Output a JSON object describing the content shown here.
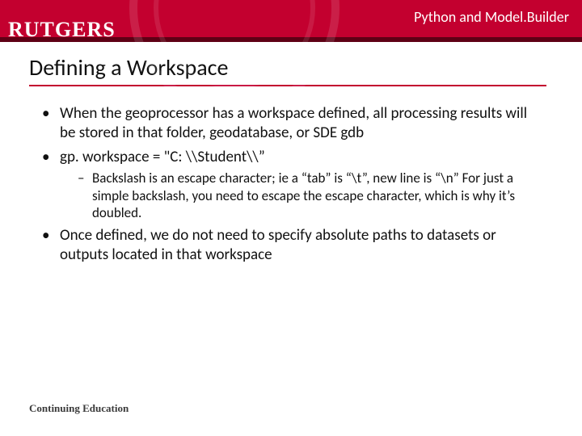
{
  "header": {
    "logo_text": "RUTGERS",
    "title": "Python and Model.Builder"
  },
  "slide": {
    "title": "Defining a Workspace"
  },
  "bullets": {
    "b1": "When the geoprocessor has a workspace defined, all processing results will be stored in that folder, geodatabase, or SDE gdb",
    "b2": "gp. workspace = \"C: \\\\Student\\\\”",
    "b2_sub": "Backslash is an escape character; ie a “tab” is “\\t”, new line is “\\n” For just a simple backslash, you need to escape the escape character, which is why it’s doubled.",
    "b3": "Once defined, we do not need to specify absolute paths to datasets or outputs located in that workspace"
  },
  "footer": {
    "text": "Continuing Education"
  }
}
